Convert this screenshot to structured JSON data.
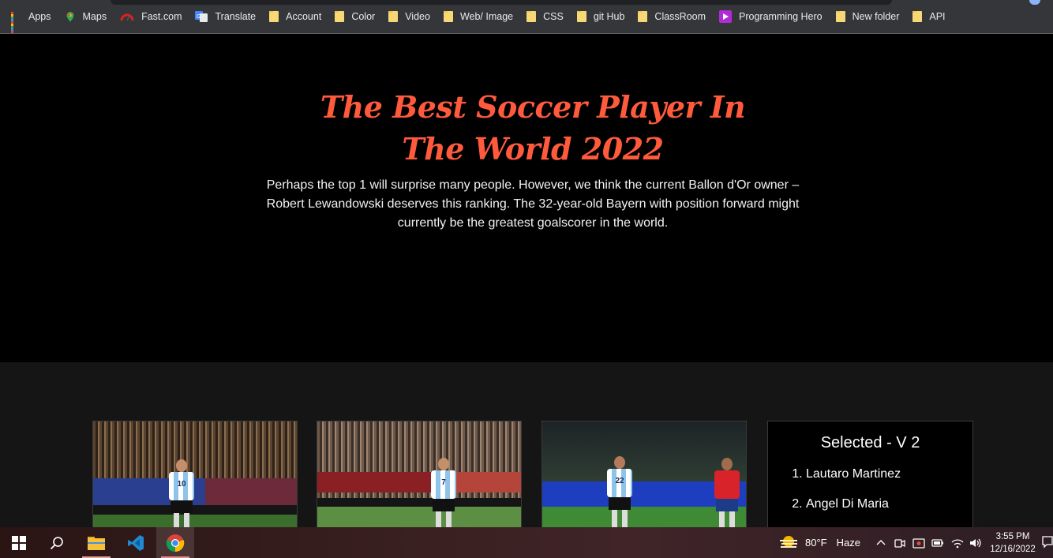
{
  "bookmarks": [
    {
      "label": "Apps",
      "icon": "apps-grid-icon"
    },
    {
      "label": "Maps",
      "icon": "maps-pin-icon"
    },
    {
      "label": "Fast.com",
      "icon": "speedometer-icon"
    },
    {
      "label": "Translate",
      "icon": "translate-icon"
    },
    {
      "label": "Account",
      "icon": "folder-icon"
    },
    {
      "label": "Color",
      "icon": "folder-icon"
    },
    {
      "label": "Video",
      "icon": "folder-icon"
    },
    {
      "label": "Web/ Image",
      "icon": "folder-icon"
    },
    {
      "label": "CSS",
      "icon": "folder-icon"
    },
    {
      "label": "git Hub",
      "icon": "folder-icon"
    },
    {
      "label": "ClassRoom",
      "icon": "folder-icon"
    },
    {
      "label": "Programming Hero",
      "icon": "programming-hero-icon"
    },
    {
      "label": "New folder",
      "icon": "folder-icon"
    },
    {
      "label": "API",
      "icon": "folder-icon"
    }
  ],
  "hero": {
    "title": "The Best Soccer Player In The World 2022",
    "description": "Perhaps the top 1 will surprise many people. However, we think the current Ballon d'Or owner – Robert Lewandowski deserves this ranking. The 32-year-old Bayern with position forward might currently be the greatest goalscorer in the world."
  },
  "players": [
    {
      "number": "10",
      "photo": "player-photo-messi"
    },
    {
      "number": "7",
      "photo": "player-photo-di-maria"
    },
    {
      "number": "22",
      "photo": "player-photo-martinez"
    }
  ],
  "selected": {
    "title": "Selected - V 2",
    "items": [
      "Lautaro Martinez",
      "Angel Di Maria"
    ]
  },
  "taskbar": {
    "weather_temp": "80°F",
    "weather_desc": "Haze",
    "time": "3:55 PM",
    "date": "12/16/2022"
  },
  "colors": {
    "title": "#ff5a3c",
    "hero_bg": "#000000",
    "section_bg": "#151515"
  }
}
